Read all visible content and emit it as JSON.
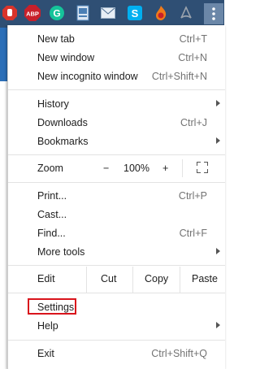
{
  "toolbar": {
    "extensions": [
      {
        "icon": "adblock-stop-icon",
        "color": "#d9342b"
      },
      {
        "icon": "abp-icon",
        "label": "ABP",
        "color": "#c8202a"
      },
      {
        "icon": "grammarly-icon",
        "label": "G",
        "color": "#15c39a"
      },
      {
        "icon": "document-extension-icon",
        "color": "#4a7fb5"
      },
      {
        "icon": "mail-icon",
        "color": "#e8eef5"
      },
      {
        "icon": "skype-icon",
        "label": "S",
        "color": "#00aff0"
      },
      {
        "icon": "fire-extension-icon",
        "color": "#f07b1a"
      },
      {
        "icon": "pdf-extension-icon",
        "color": "#9aa3ad"
      }
    ],
    "menu_button_icon": "three-dots-vertical-icon"
  },
  "menu": {
    "new_tab": {
      "label": "New tab",
      "shortcut": "Ctrl+T"
    },
    "new_window": {
      "label": "New window",
      "shortcut": "Ctrl+N"
    },
    "new_incognito": {
      "label": "New incognito window",
      "shortcut": "Ctrl+Shift+N"
    },
    "history": {
      "label": "History"
    },
    "downloads": {
      "label": "Downloads",
      "shortcut": "Ctrl+J"
    },
    "bookmarks": {
      "label": "Bookmarks"
    },
    "zoom": {
      "label": "Zoom",
      "minus": "−",
      "level": "100%",
      "plus": "+"
    },
    "print": {
      "label": "Print...",
      "shortcut": "Ctrl+P"
    },
    "cast": {
      "label": "Cast..."
    },
    "find": {
      "label": "Find...",
      "shortcut": "Ctrl+F"
    },
    "more_tools": {
      "label": "More tools"
    },
    "edit": {
      "label": "Edit",
      "cut": "Cut",
      "copy": "Copy",
      "paste": "Paste"
    },
    "settings": {
      "label": "Settings"
    },
    "help": {
      "label": "Help"
    },
    "exit": {
      "label": "Exit",
      "shortcut": "Ctrl+Shift+Q"
    }
  },
  "highlight_color": "#d9141c"
}
